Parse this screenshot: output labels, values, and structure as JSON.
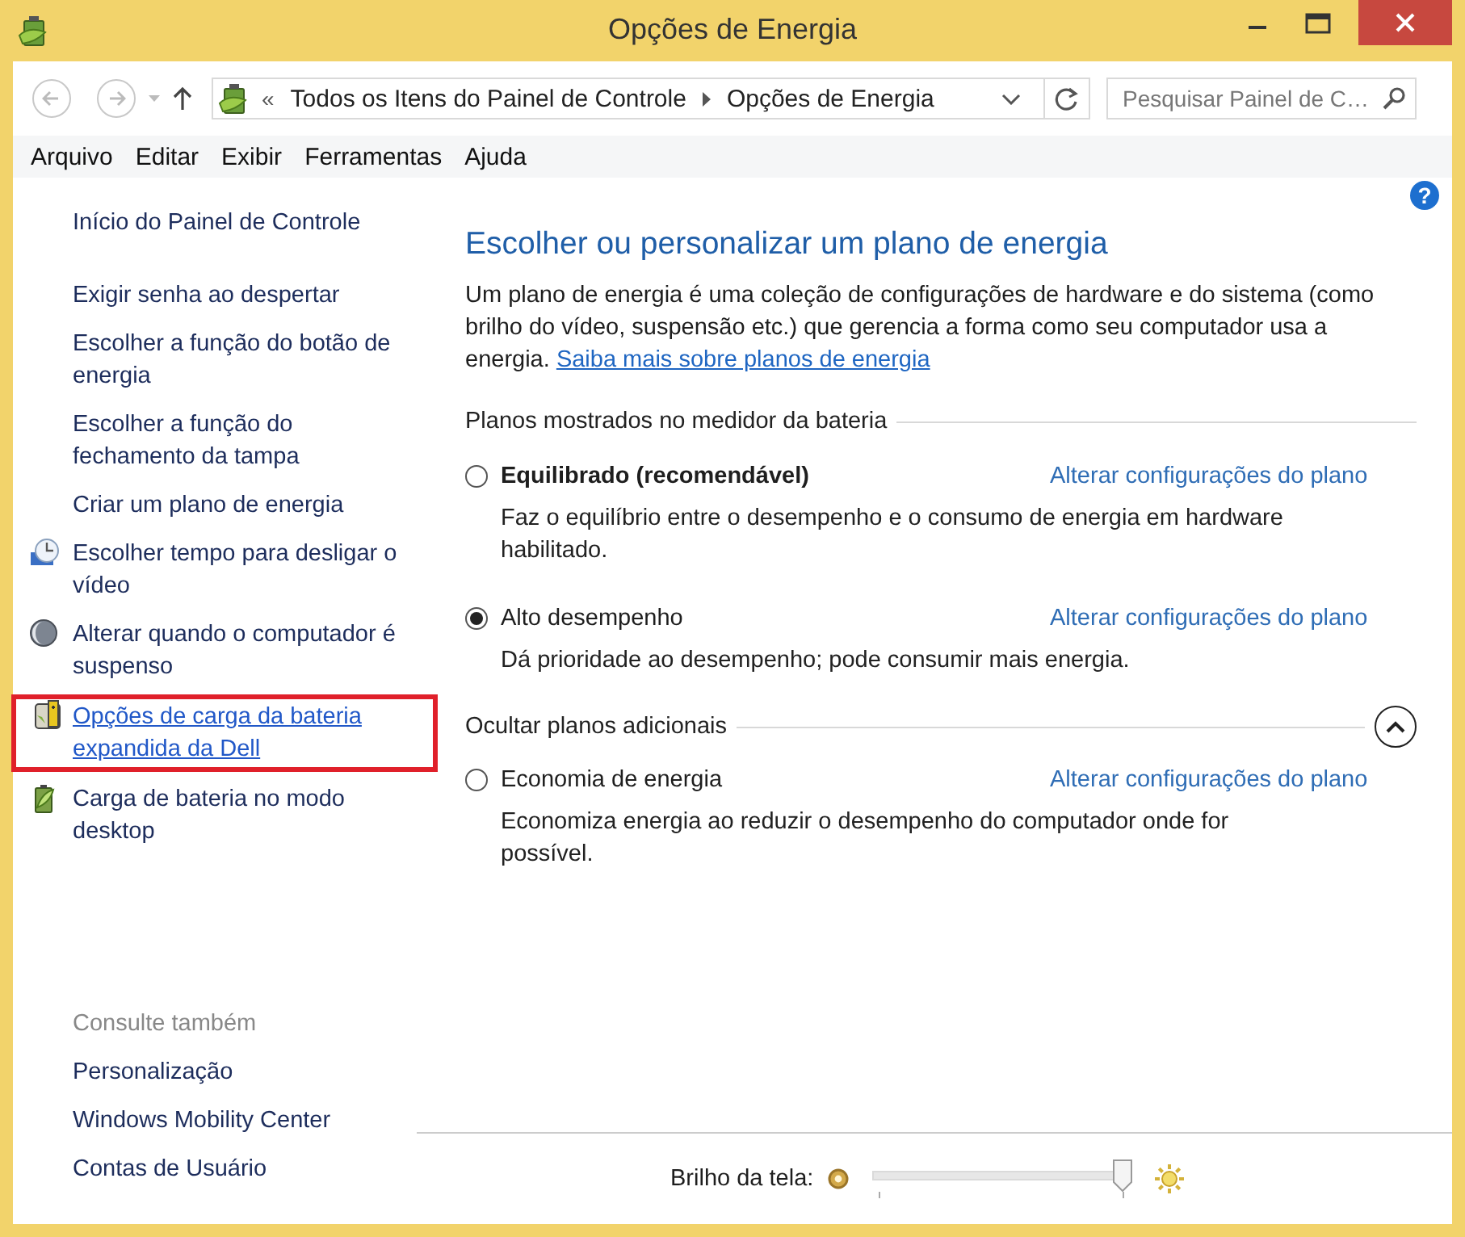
{
  "window": {
    "title": "Opções de Energia"
  },
  "nav": {
    "prefix": "«",
    "breadcrumbs": [
      "Todos os Itens do Painel de Controle",
      "Opções de Energia"
    ],
    "search": {
      "placeholder": "Pesquisar Painel de C…"
    }
  },
  "menu": [
    "Arquivo",
    "Editar",
    "Exibir",
    "Ferramentas",
    "Ajuda"
  ],
  "sidebar": {
    "home": "Início do Painel de Controle",
    "tasks": [
      {
        "label": "Exigir senha ao despertar",
        "kind": "link",
        "highlighted": false
      },
      {
        "label": "Escolher a função do botão de energia",
        "kind": "link",
        "highlighted": false
      },
      {
        "label": "Escolher a função do fechamento da tampa",
        "kind": "link",
        "highlighted": false
      },
      {
        "label": "Criar um plano de energia",
        "kind": "link",
        "highlighted": false
      },
      {
        "label": "Escolher tempo para desligar o vídeo",
        "kind": "icon-link",
        "highlighted": false
      },
      {
        "label": "Alterar quando o computador é suspenso",
        "kind": "icon-link",
        "highlighted": false
      },
      {
        "label": "Opções de carga da bateria expandida da Dell",
        "kind": "icon-link",
        "highlighted": true
      },
      {
        "label": "Carga de bateria no modo desktop",
        "kind": "icon-link",
        "highlighted": false
      }
    ],
    "see_also": {
      "title": "Consulte também",
      "items": [
        "Personalização",
        "Windows Mobility Center",
        "Contas de Usuário"
      ]
    }
  },
  "main": {
    "help": "?",
    "heading": "Escolher ou personalizar um plano de energia",
    "intro": "Um plano de energia é uma coleção de configurações de hardware e do sistema (como brilho do vídeo, suspensão etc.) que gerencia a forma como seu computador usa a energia. ",
    "intro_link": "Saiba mais sobre planos de energia",
    "sections": [
      {
        "title": "Planos mostrados no medidor da bateria",
        "kind": "header",
        "plans": [
          {
            "name": "Equilibrado (recomendável)",
            "recommended": true,
            "selected": false,
            "link": "Alterar configurações do plano",
            "description": "Faz o equilíbrio entre o desempenho e o consumo de energia em hardware habilitado."
          },
          {
            "name": "Alto desempenho",
            "recommended": false,
            "selected": true,
            "link": "Alterar configurações do plano",
            "description": "Dá prioridade ao desempenho; pode consumir mais energia."
          }
        ]
      },
      {
        "title": "Ocultar planos adicionais",
        "kind": "collapsible",
        "expanded": true,
        "plans": [
          {
            "name": "Economia de energia",
            "recommended": false,
            "selected": false,
            "link": "Alterar configurações do plano",
            "description": "Economiza energia ao reduzir o desempenho do computador onde for possível."
          }
        ]
      }
    ]
  },
  "brightness": {
    "label": "Brilho da tela:",
    "level": 0.97
  }
}
